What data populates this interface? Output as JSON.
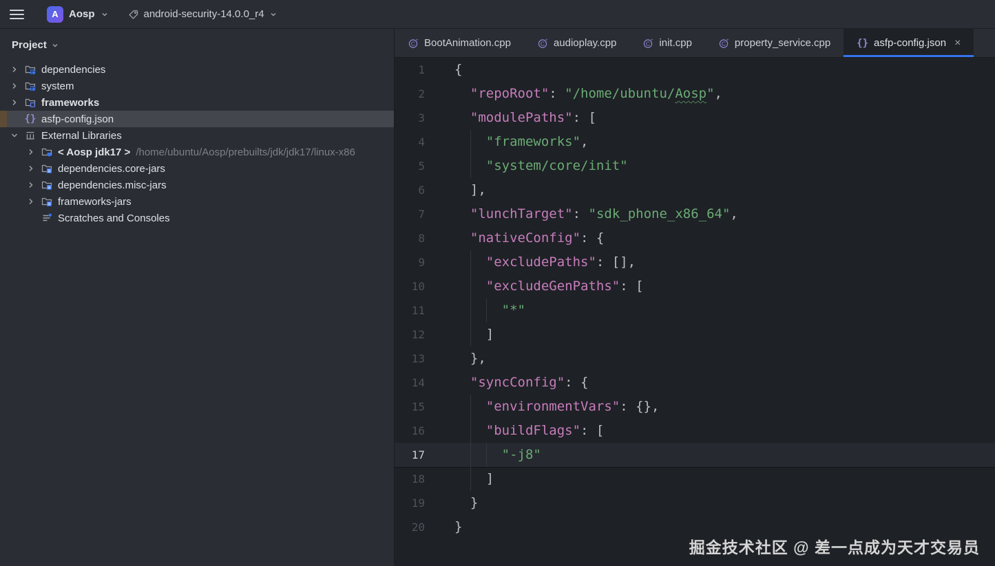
{
  "topbar": {
    "project_badge_letter": "A",
    "project_name": "Aosp",
    "branch_name": "android-security-14.0.0_r4"
  },
  "sidebar": {
    "title": "Project",
    "items": [
      {
        "indent": 0,
        "chevron": "collapsed",
        "icon": "module-folder",
        "label": "dependencies"
      },
      {
        "indent": 0,
        "chevron": "collapsed",
        "icon": "module-folder",
        "label": "system"
      },
      {
        "indent": 0,
        "chevron": "collapsed",
        "icon": "source-folder",
        "label": "frameworks",
        "bold": true
      },
      {
        "indent": 0,
        "chevron": "none",
        "icon": "json",
        "label": "asfp-config.json",
        "selected": true
      },
      {
        "indent": 0,
        "chevron": "expanded",
        "icon": "library",
        "label": "External Libraries"
      },
      {
        "indent": 1,
        "chevron": "collapsed",
        "icon": "jdk-folder",
        "label": "< Aosp jdk17 >",
        "bold": true,
        "sublabel": "/home/ubuntu/Aosp/prebuilts/jdk/jdk17/linux-x86"
      },
      {
        "indent": 1,
        "chevron": "collapsed",
        "icon": "jar-folder",
        "label": "dependencies.core-jars"
      },
      {
        "indent": 1,
        "chevron": "collapsed",
        "icon": "jar-folder",
        "label": "dependencies.misc-jars"
      },
      {
        "indent": 1,
        "chevron": "collapsed",
        "icon": "jar-folder",
        "label": "frameworks-jars"
      },
      {
        "indent": 1,
        "chevron": "none",
        "icon": "scratches",
        "label": "Scratches and Consoles"
      }
    ]
  },
  "tabs": [
    {
      "icon": "cpp",
      "label": "BootAnimation.cpp"
    },
    {
      "icon": "cpp",
      "label": "audioplay.cpp"
    },
    {
      "icon": "cpp",
      "label": "init.cpp"
    },
    {
      "icon": "cpp",
      "label": "property_service.cpp"
    },
    {
      "icon": "json",
      "label": "asfp-config.json",
      "active": true,
      "closable": true
    }
  ],
  "editor": {
    "current_line": 17,
    "lines": [
      {
        "n": 1,
        "t": [
          [
            "p",
            "{"
          ]
        ]
      },
      {
        "n": 2,
        "t": [
          [
            "w",
            "  "
          ],
          [
            "k",
            "\"repoRoot\""
          ],
          [
            "p",
            ": "
          ],
          [
            "s",
            "\"/home/ubuntu/"
          ],
          [
            "sw",
            "Aosp"
          ],
          [
            "s",
            "\""
          ],
          [
            "p",
            ","
          ]
        ]
      },
      {
        "n": 3,
        "t": [
          [
            "w",
            "  "
          ],
          [
            "k",
            "\"modulePaths\""
          ],
          [
            "p",
            ": ["
          ]
        ]
      },
      {
        "n": 4,
        "t": [
          [
            "w",
            "    "
          ],
          [
            "s",
            "\"frameworks\""
          ],
          [
            "p",
            ","
          ]
        ]
      },
      {
        "n": 5,
        "t": [
          [
            "w",
            "    "
          ],
          [
            "s",
            "\"system/core/init\""
          ]
        ]
      },
      {
        "n": 6,
        "t": [
          [
            "w",
            "  "
          ],
          [
            "p",
            "],"
          ]
        ]
      },
      {
        "n": 7,
        "t": [
          [
            "w",
            "  "
          ],
          [
            "k",
            "\"lunchTarget\""
          ],
          [
            "p",
            ": "
          ],
          [
            "s",
            "\"sdk_phone_x86_64\""
          ],
          [
            "p",
            ","
          ]
        ]
      },
      {
        "n": 8,
        "t": [
          [
            "w",
            "  "
          ],
          [
            "k",
            "\"nativeConfig\""
          ],
          [
            "p",
            ": {"
          ]
        ]
      },
      {
        "n": 9,
        "t": [
          [
            "w",
            "    "
          ],
          [
            "k",
            "\"excludePaths\""
          ],
          [
            "p",
            ": [],"
          ]
        ]
      },
      {
        "n": 10,
        "t": [
          [
            "w",
            "    "
          ],
          [
            "k",
            "\"excludeGenPaths\""
          ],
          [
            "p",
            ": ["
          ]
        ]
      },
      {
        "n": 11,
        "t": [
          [
            "w",
            "      "
          ],
          [
            "s",
            "\"*\""
          ]
        ]
      },
      {
        "n": 12,
        "t": [
          [
            "w",
            "    "
          ],
          [
            "p",
            "]"
          ]
        ]
      },
      {
        "n": 13,
        "t": [
          [
            "w",
            "  "
          ],
          [
            "p",
            "},"
          ]
        ]
      },
      {
        "n": 14,
        "t": [
          [
            "w",
            "  "
          ],
          [
            "k",
            "\"syncConfig\""
          ],
          [
            "p",
            ": {"
          ]
        ]
      },
      {
        "n": 15,
        "t": [
          [
            "w",
            "    "
          ],
          [
            "k",
            "\"environmentVars\""
          ],
          [
            "p",
            ": {},"
          ]
        ]
      },
      {
        "n": 16,
        "t": [
          [
            "w",
            "    "
          ],
          [
            "k",
            "\"buildFlags\""
          ],
          [
            "p",
            ": ["
          ]
        ]
      },
      {
        "n": 17,
        "t": [
          [
            "w",
            "      "
          ],
          [
            "s",
            "\"-j8\""
          ]
        ]
      },
      {
        "n": 18,
        "t": [
          [
            "w",
            "    "
          ],
          [
            "p",
            "]"
          ]
        ]
      },
      {
        "n": 19,
        "t": [
          [
            "w",
            "  "
          ],
          [
            "p",
            "}"
          ]
        ]
      },
      {
        "n": 20,
        "t": [
          [
            "p",
            "}"
          ]
        ]
      }
    ]
  },
  "watermark": "掘金技术社区 @ 差一点成为天才交易员",
  "colors": {
    "accent_blue": "#3574f0",
    "json_key_pink": "#c77dbb",
    "string_green": "#6aab73",
    "selection_gray": "#43464c",
    "selection_left_mark": "#5d4b35",
    "current_line": "#26292f",
    "panel_bg": "#2a2d34",
    "editor_bg": "#1e2126"
  }
}
